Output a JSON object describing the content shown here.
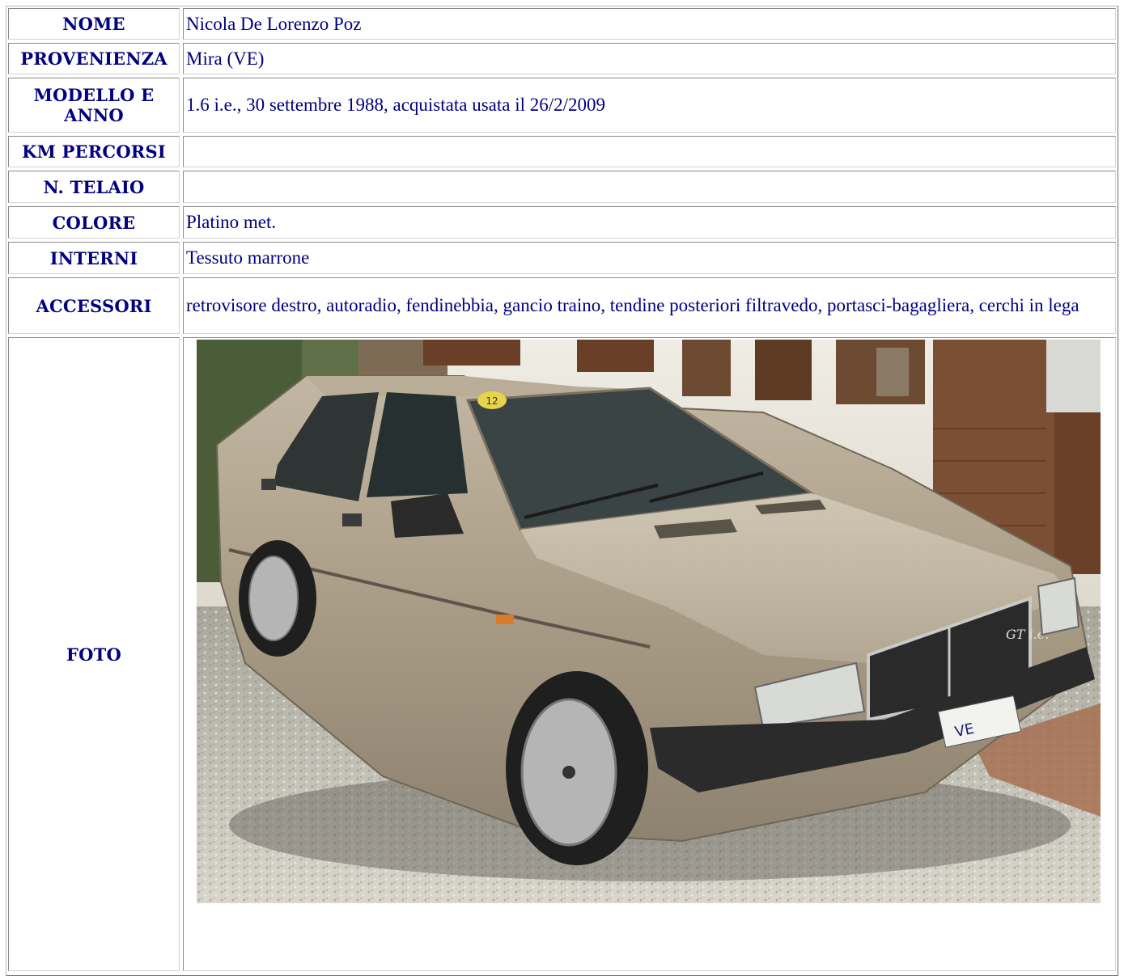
{
  "rows": [
    {
      "label": "NOME",
      "value": "Nicola De Lorenzo Poz"
    },
    {
      "label": "PROVENIENZA",
      "value": "Mira (VE)"
    },
    {
      "label": "MODELLO E ANNO",
      "value": "1.6 i.e., 30 settembre 1988, acquistata usata il 26/2/2009"
    },
    {
      "label": "KM PERCORSI",
      "value": ""
    },
    {
      "label": "N. TELAIO",
      "value": ""
    },
    {
      "label": "COLORE",
      "value": "Platino met."
    },
    {
      "label": "INTERNI",
      "value": "Tessuto marrone"
    },
    {
      "label": "ACCESSORI",
      "value": "retrovisore destro, autoradio, fendinebbia, gancio traino, tendine posteriori filtravedo, portasci-bagagliera, cerchi in lega"
    },
    {
      "label": "FOTO",
      "value": ""
    }
  ],
  "photo": {
    "subject": "car-photo",
    "windshield_sticker": "12",
    "plate_text": "VE",
    "badge_text": "GT i.e."
  },
  "colors": {
    "text": "#000080",
    "border_dark": "#8a8a8a",
    "border_light": "#d4d4d4"
  }
}
